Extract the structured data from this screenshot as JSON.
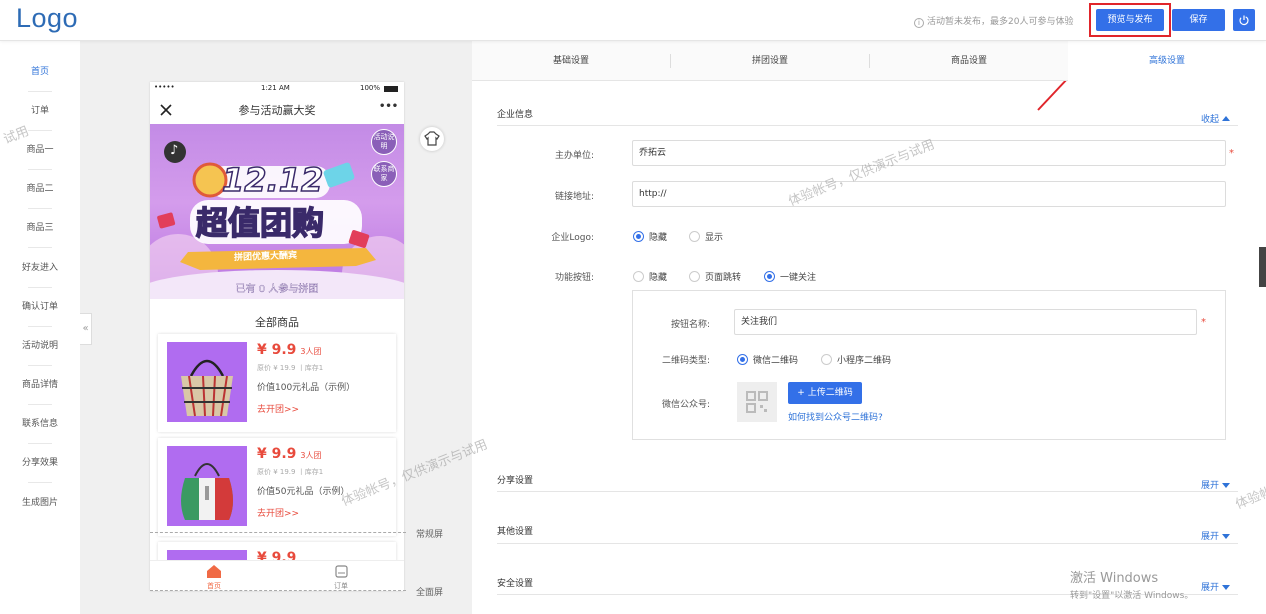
{
  "header": {
    "logo": "Logo",
    "notice": "活动暂未发布，最多20人可参与体验",
    "publish_label": "预览与发布",
    "save_label": "保存"
  },
  "sidebar": {
    "items": [
      "首页",
      "订单",
      "商品一",
      "商品二",
      "商品三",
      "好友进入",
      "确认订单",
      "活动说明",
      "商品详情",
      "联系信息",
      "分享效果",
      "生成图片"
    ]
  },
  "preview": {
    "status_time": "1:21 AM",
    "status_battery": "100%",
    "status_signal": "•••••",
    "nav_title": "参与活动赢大奖",
    "nav_more": "•••",
    "banner": {
      "title_num": "12.12",
      "title_main": "超值团购",
      "ribbon": "拼团优惠大酬宾",
      "participants": "已有 0 人参与拼团",
      "bubble1": "活动说明",
      "bubble2": "联系商家"
    },
    "section_title": "全部商品",
    "products": [
      {
        "price": "¥ 9.9",
        "group": "3人团",
        "orig": "原价 ¥ 19.9 丨库存1",
        "desc": "价值100元礼品（示例）",
        "go": "去开团>>"
      },
      {
        "price": "¥ 9.9",
        "group": "3人团",
        "orig": "原价 ¥ 19.9 丨库存1",
        "desc": "价值50元礼品（示例）",
        "go": "去开团>>"
      },
      {
        "price": "¥ 9.9"
      }
    ],
    "tabbar": {
      "home": "首页",
      "order": "订单"
    },
    "normal_screen": "常规屏",
    "full_screen": "全面屏",
    "collapse": "«"
  },
  "tabs": [
    "基础设置",
    "拼团设置",
    "商品设置",
    "高级设置"
  ],
  "company": {
    "title": "企业信息",
    "toggle": "收起",
    "host_label": "主办单位:",
    "host_value": "乔拓云",
    "link_label": "链接地址:",
    "link_value": "http://",
    "logo_label": "企业Logo:",
    "logo_options": [
      "隐藏",
      "显示"
    ],
    "func_label": "功能按钮:",
    "func_options": [
      "隐藏",
      "页面跳转",
      "一键关注"
    ],
    "btn_name_label": "按钮名称:",
    "btn_name_value": "关注我们",
    "qr_type_label": "二维码类型:",
    "qr_type_options": [
      "微信二维码",
      "小程序二维码"
    ],
    "wechat_label": "微信公众号:",
    "upload_label": "+ 上传二维码",
    "find_qr_link": "如何找到公众号二维码?"
  },
  "sections": [
    {
      "title": "分享设置",
      "toggle": "展开"
    },
    {
      "title": "其他设置",
      "toggle": "展开"
    },
    {
      "title": "安全设置",
      "toggle": "展开"
    }
  ],
  "watermark": "体验帐号，仅供演示与试用",
  "watermark_short": "体验帐",
  "watermark_left": "试用",
  "windows": {
    "line1": "激活 Windows",
    "line2": "转到\"设置\"以激活 Windows。"
  },
  "colors": {
    "accent": "#3370e8",
    "highlight": "#e0252b",
    "price": "#e84a3c",
    "thumb": "#b06cf0"
  }
}
